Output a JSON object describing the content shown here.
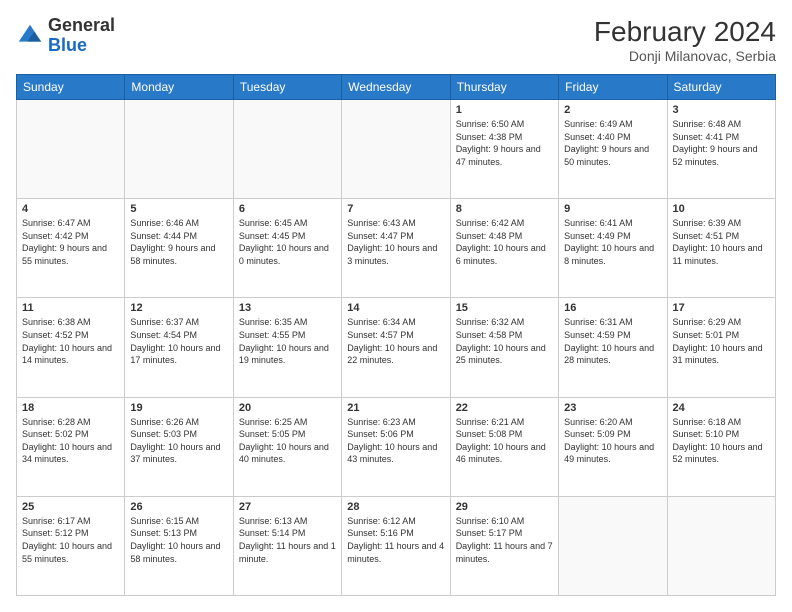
{
  "header": {
    "logo_general": "General",
    "logo_blue": "Blue",
    "month_year": "February 2024",
    "location": "Donji Milanovac, Serbia"
  },
  "weekdays": [
    "Sunday",
    "Monday",
    "Tuesday",
    "Wednesday",
    "Thursday",
    "Friday",
    "Saturday"
  ],
  "weeks": [
    [
      {
        "day": "",
        "empty": true
      },
      {
        "day": "",
        "empty": true
      },
      {
        "day": "",
        "empty": true
      },
      {
        "day": "",
        "empty": true
      },
      {
        "day": "1",
        "sunrise": "6:50 AM",
        "sunset": "4:38 PM",
        "daylight": "9 hours and 47 minutes."
      },
      {
        "day": "2",
        "sunrise": "6:49 AM",
        "sunset": "4:40 PM",
        "daylight": "9 hours and 50 minutes."
      },
      {
        "day": "3",
        "sunrise": "6:48 AM",
        "sunset": "4:41 PM",
        "daylight": "9 hours and 52 minutes."
      }
    ],
    [
      {
        "day": "4",
        "sunrise": "6:47 AM",
        "sunset": "4:42 PM",
        "daylight": "9 hours and 55 minutes."
      },
      {
        "day": "5",
        "sunrise": "6:46 AM",
        "sunset": "4:44 PM",
        "daylight": "9 hours and 58 minutes."
      },
      {
        "day": "6",
        "sunrise": "6:45 AM",
        "sunset": "4:45 PM",
        "daylight": "10 hours and 0 minutes."
      },
      {
        "day": "7",
        "sunrise": "6:43 AM",
        "sunset": "4:47 PM",
        "daylight": "10 hours and 3 minutes."
      },
      {
        "day": "8",
        "sunrise": "6:42 AM",
        "sunset": "4:48 PM",
        "daylight": "10 hours and 6 minutes."
      },
      {
        "day": "9",
        "sunrise": "6:41 AM",
        "sunset": "4:49 PM",
        "daylight": "10 hours and 8 minutes."
      },
      {
        "day": "10",
        "sunrise": "6:39 AM",
        "sunset": "4:51 PM",
        "daylight": "10 hours and 11 minutes."
      }
    ],
    [
      {
        "day": "11",
        "sunrise": "6:38 AM",
        "sunset": "4:52 PM",
        "daylight": "10 hours and 14 minutes."
      },
      {
        "day": "12",
        "sunrise": "6:37 AM",
        "sunset": "4:54 PM",
        "daylight": "10 hours and 17 minutes."
      },
      {
        "day": "13",
        "sunrise": "6:35 AM",
        "sunset": "4:55 PM",
        "daylight": "10 hours and 19 minutes."
      },
      {
        "day": "14",
        "sunrise": "6:34 AM",
        "sunset": "4:57 PM",
        "daylight": "10 hours and 22 minutes."
      },
      {
        "day": "15",
        "sunrise": "6:32 AM",
        "sunset": "4:58 PM",
        "daylight": "10 hours and 25 minutes."
      },
      {
        "day": "16",
        "sunrise": "6:31 AM",
        "sunset": "4:59 PM",
        "daylight": "10 hours and 28 minutes."
      },
      {
        "day": "17",
        "sunrise": "6:29 AM",
        "sunset": "5:01 PM",
        "daylight": "10 hours and 31 minutes."
      }
    ],
    [
      {
        "day": "18",
        "sunrise": "6:28 AM",
        "sunset": "5:02 PM",
        "daylight": "10 hours and 34 minutes."
      },
      {
        "day": "19",
        "sunrise": "6:26 AM",
        "sunset": "5:03 PM",
        "daylight": "10 hours and 37 minutes."
      },
      {
        "day": "20",
        "sunrise": "6:25 AM",
        "sunset": "5:05 PM",
        "daylight": "10 hours and 40 minutes."
      },
      {
        "day": "21",
        "sunrise": "6:23 AM",
        "sunset": "5:06 PM",
        "daylight": "10 hours and 43 minutes."
      },
      {
        "day": "22",
        "sunrise": "6:21 AM",
        "sunset": "5:08 PM",
        "daylight": "10 hours and 46 minutes."
      },
      {
        "day": "23",
        "sunrise": "6:20 AM",
        "sunset": "5:09 PM",
        "daylight": "10 hours and 49 minutes."
      },
      {
        "day": "24",
        "sunrise": "6:18 AM",
        "sunset": "5:10 PM",
        "daylight": "10 hours and 52 minutes."
      }
    ],
    [
      {
        "day": "25",
        "sunrise": "6:17 AM",
        "sunset": "5:12 PM",
        "daylight": "10 hours and 55 minutes."
      },
      {
        "day": "26",
        "sunrise": "6:15 AM",
        "sunset": "5:13 PM",
        "daylight": "10 hours and 58 minutes."
      },
      {
        "day": "27",
        "sunrise": "6:13 AM",
        "sunset": "5:14 PM",
        "daylight": "11 hours and 1 minute."
      },
      {
        "day": "28",
        "sunrise": "6:12 AM",
        "sunset": "5:16 PM",
        "daylight": "11 hours and 4 minutes."
      },
      {
        "day": "29",
        "sunrise": "6:10 AM",
        "sunset": "5:17 PM",
        "daylight": "11 hours and 7 minutes."
      },
      {
        "day": "",
        "empty": true
      },
      {
        "day": "",
        "empty": true
      }
    ]
  ]
}
